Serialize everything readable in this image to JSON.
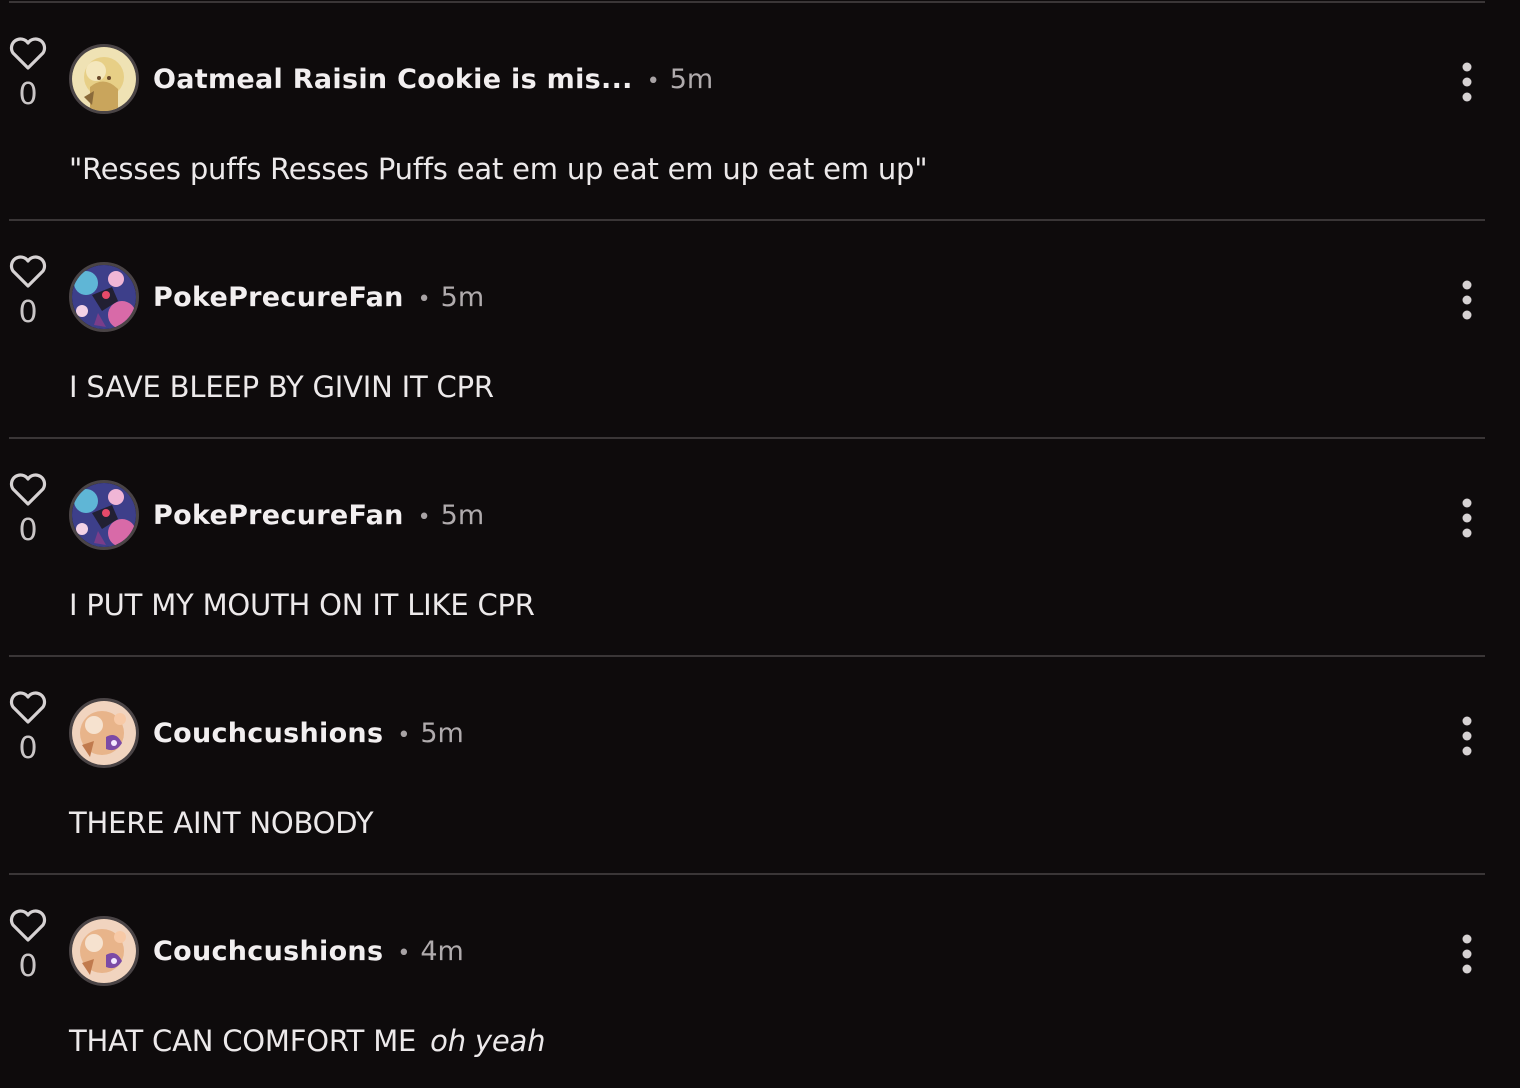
{
  "comments": [
    {
      "likes": "0",
      "username": "Oatmeal Raisin Cookie is mis...",
      "separator": "•",
      "time": "5m",
      "text": "\"Resses puffs Resses Puffs eat em up eat em up eat em up\"",
      "text_italic": "",
      "avatar": "oatmeal-raisin-cookie-avatar"
    },
    {
      "likes": "0",
      "username": "PokePrecureFan",
      "separator": "•",
      "time": "5m",
      "text": "I SAVE BLEEP BY GIVIN IT CPR",
      "text_italic": "",
      "avatar": "pokeprecurefan-avatar"
    },
    {
      "likes": "0",
      "username": "PokePrecureFan",
      "separator": "•",
      "time": "5m",
      "text": "I PUT MY MOUTH ON IT LIKE CPR",
      "text_italic": "",
      "avatar": "pokeprecurefan-avatar"
    },
    {
      "likes": "0",
      "username": "Couchcushions",
      "separator": "•",
      "time": "5m",
      "text": "THERE AINT NOBODY",
      "text_italic": "",
      "avatar": "couchcushions-avatar"
    },
    {
      "likes": "0",
      "username": "Couchcushions",
      "separator": "•",
      "time": "4m",
      "text": "THAT CAN COMFORT ME",
      "text_italic": "oh yeah",
      "avatar": "couchcushions-avatar"
    }
  ],
  "icons": {
    "like": "heart-outline-icon",
    "menu": "more-vertical-icon"
  },
  "colors": {
    "background": "#0e0b0c",
    "divider": "#3a3637",
    "text": "#ece9ea",
    "muted": "#b0abad"
  }
}
